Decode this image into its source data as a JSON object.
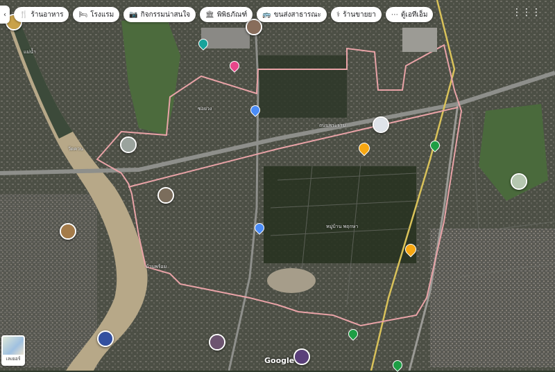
{
  "chips": [
    {
      "icon": "fork-knife-icon",
      "label": "ร้านอาหาร"
    },
    {
      "icon": "bed-icon",
      "label": "โรงแรม"
    },
    {
      "icon": "camera-icon",
      "label": "กิจกรรมน่าสนใจ"
    },
    {
      "icon": "museum-icon",
      "label": "พิพิธภัณฑ์"
    },
    {
      "icon": "bus-icon",
      "label": "ขนส่งสาธารณะ"
    },
    {
      "icon": "pharmacy-icon",
      "label": "ร้านขายยา"
    },
    {
      "icon": "more-icon",
      "label": "ตู้เอทีเอ็ม"
    }
  ],
  "collapse_label": "‹",
  "layers_label": "เลเยอร์",
  "google_label": "Google",
  "map_labels": [
    {
      "text": "ซอยวง"
    },
    {
      "text": "วัดควน"
    },
    {
      "text": "แม่น้ำ"
    },
    {
      "text": "บ้านพร้อม"
    },
    {
      "text": "หมู่บ้าน พฤกษา"
    },
    {
      "text": "ถนนพระราม"
    }
  ],
  "colors": {
    "boundary": "#e9a3a7",
    "river": "#b7a888",
    "rail": "#d9c25a",
    "road": "#8e8f8b"
  }
}
